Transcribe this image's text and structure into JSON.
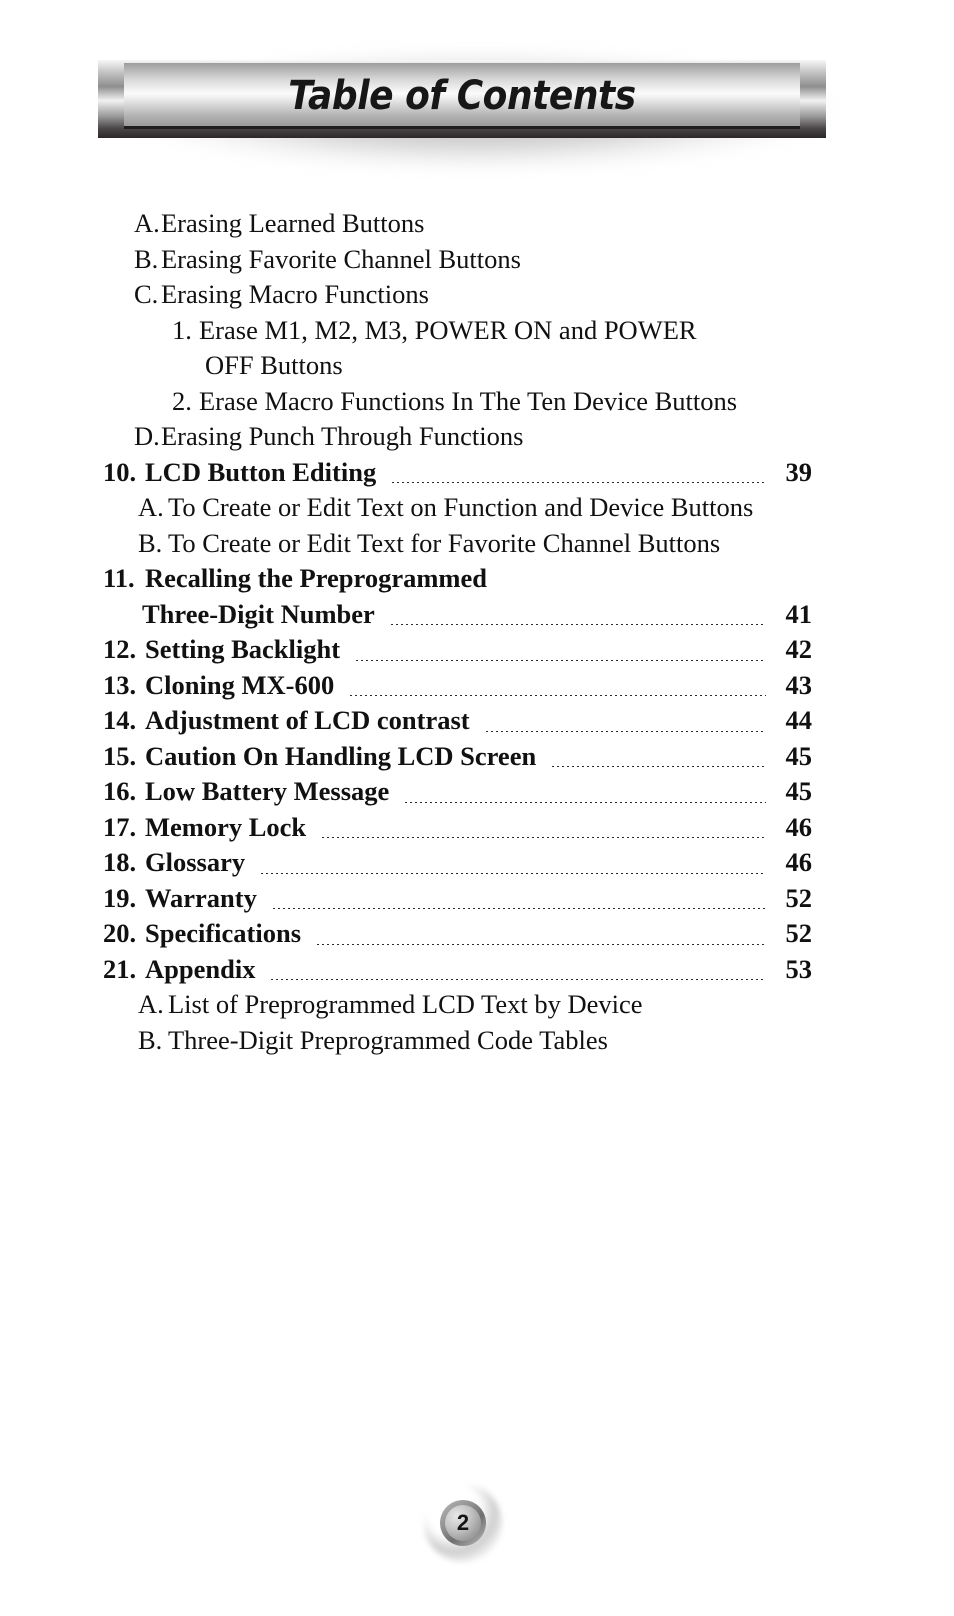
{
  "document": {
    "header_title": "Table of Contents",
    "page_number": "2"
  },
  "toc": {
    "entries": [
      {
        "marker": "A.",
        "label": "Erasing Learned Buttons",
        "level": "letter",
        "bold": false,
        "page": ""
      },
      {
        "marker": "B.",
        "label": "Erasing Favorite Channel Buttons",
        "level": "letter",
        "bold": false,
        "page": ""
      },
      {
        "marker": "C.",
        "label": "Erasing Macro Functions",
        "level": "letter",
        "bold": false,
        "page": ""
      },
      {
        "marker": "1.",
        "label": "Erase M1, M2, M3, POWER ON and POWER",
        "level": "digit",
        "bold": false,
        "page": ""
      },
      {
        "marker": "",
        "label": "OFF Buttons",
        "level": "continuation",
        "bold": false,
        "page": ""
      },
      {
        "marker": "2.",
        "label": "Erase Macro Functions In The Ten Device Buttons",
        "level": "digit",
        "bold": false,
        "page": ""
      },
      {
        "marker": "D.",
        "label": "Erasing Punch Through Functions",
        "level": "letter",
        "bold": false,
        "page": ""
      },
      {
        "marker": "10.",
        "label": "LCD Button Editing",
        "level": "number",
        "bold": true,
        "page": "39"
      },
      {
        "marker": "A.",
        "label": "To Create or Edit Text on Function and Device Buttons",
        "level": "letterA",
        "bold": false,
        "page": ""
      },
      {
        "marker": "B.",
        "label": "To Create or Edit Text for Favorite Channel Buttons",
        "level": "letterA",
        "bold": false,
        "page": ""
      },
      {
        "marker": "11.",
        "label": "Recalling the Preprogrammed",
        "level": "number",
        "bold": true,
        "page": ""
      },
      {
        "marker": "",
        "label": "Three-Digit Number",
        "level": "wrap2",
        "bold": true,
        "page": "41"
      },
      {
        "marker": "12.",
        "label": "Setting Backlight",
        "level": "number",
        "bold": true,
        "page": "42"
      },
      {
        "marker": "13.",
        "label": "Cloning MX-600",
        "level": "number",
        "bold": true,
        "page": "43"
      },
      {
        "marker": "14.",
        "label": "Adjustment of LCD contrast",
        "level": "number",
        "bold": true,
        "page": "44"
      },
      {
        "marker": "15.",
        "label": "Caution On Handling LCD Screen",
        "level": "number",
        "bold": true,
        "page": "45"
      },
      {
        "marker": "16.",
        "label": "Low Battery Message",
        "level": "number",
        "bold": true,
        "page": "45"
      },
      {
        "marker": "17.",
        "label": "Memory Lock",
        "level": "number",
        "bold": true,
        "page": "46"
      },
      {
        "marker": "18.",
        "label": "Glossary",
        "level": "number",
        "bold": true,
        "page": "46"
      },
      {
        "marker": "19.",
        "label": "Warranty",
        "level": "number",
        "bold": true,
        "page": "52"
      },
      {
        "marker": "20.",
        "label": "Specifications",
        "level": "number",
        "bold": true,
        "page": "52"
      },
      {
        "marker": "21.",
        "label": "Appendix",
        "level": "number",
        "bold": true,
        "page": "53"
      },
      {
        "marker": "A.",
        "label": "List of Preprogrammed LCD Text by Device",
        "level": "letterA",
        "bold": false,
        "page": ""
      },
      {
        "marker": "B.",
        "label": "Three-Digit Preprogrammed Code Tables",
        "level": "letterA",
        "bold": false,
        "page": ""
      }
    ]
  }
}
